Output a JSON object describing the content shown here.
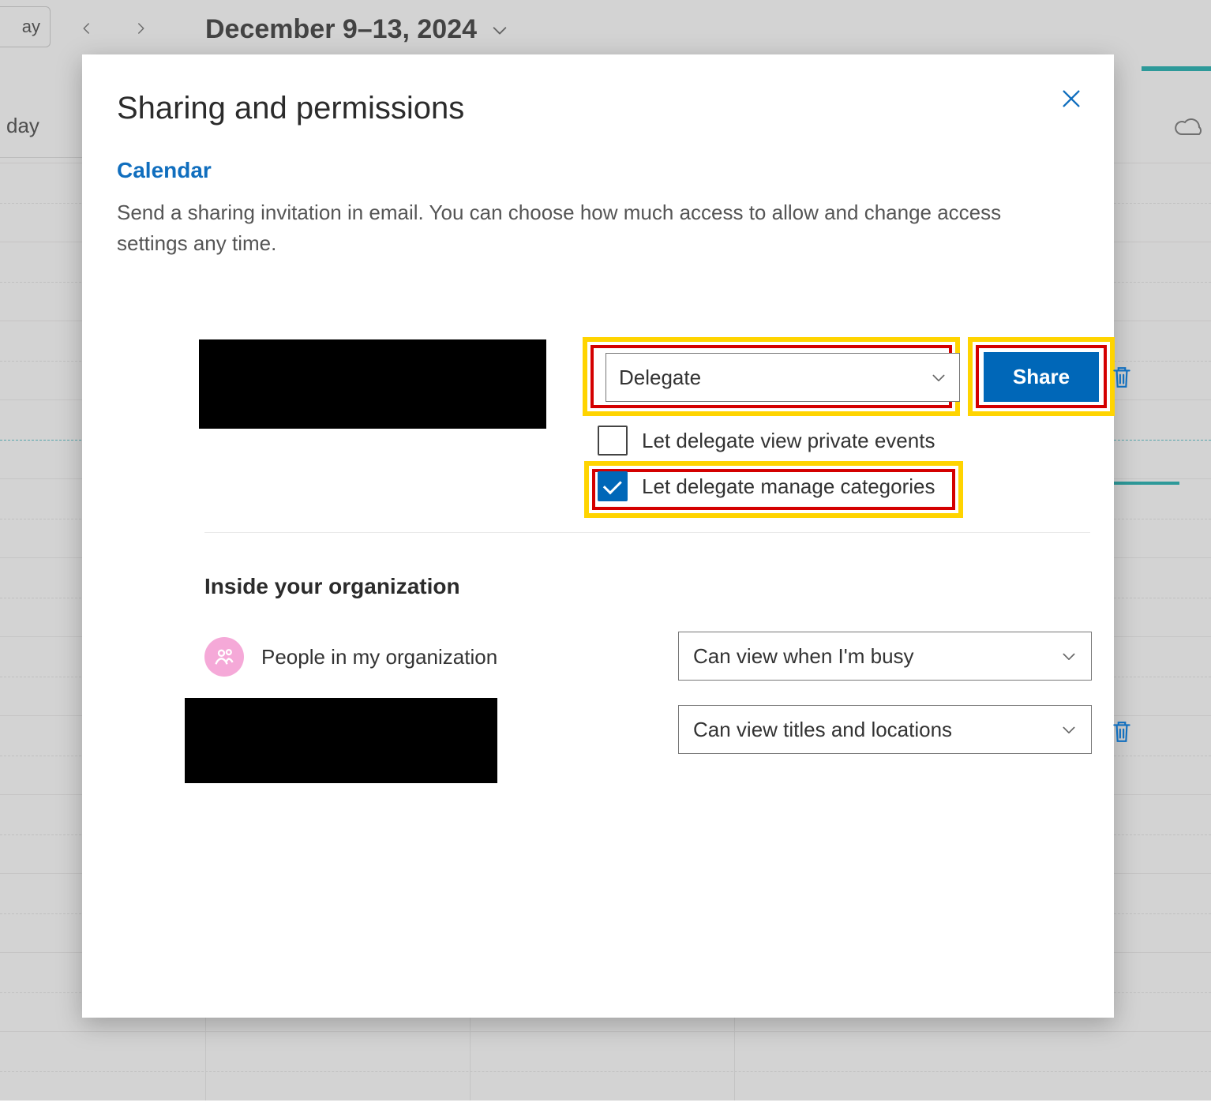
{
  "background": {
    "today_label": "ay",
    "date_range": "December 9–13, 2024",
    "day_header": "day"
  },
  "modal": {
    "title": "Sharing and permissions",
    "calendar_label": "Calendar",
    "description": "Send a sharing invitation in email. You can choose how much access to allow and change access settings any time.",
    "permission_select_value": "Delegate",
    "share_button": "Share",
    "checkbox_private_label": "Let delegate view private events",
    "checkbox_private_checked": false,
    "checkbox_categories_label": "Let delegate manage categories",
    "checkbox_categories_checked": true,
    "org_heading": "Inside your organization",
    "org_people_label": "People in my organization",
    "org_people_permission": "Can view when I'm busy",
    "user_permission": "Can view titles and locations"
  }
}
